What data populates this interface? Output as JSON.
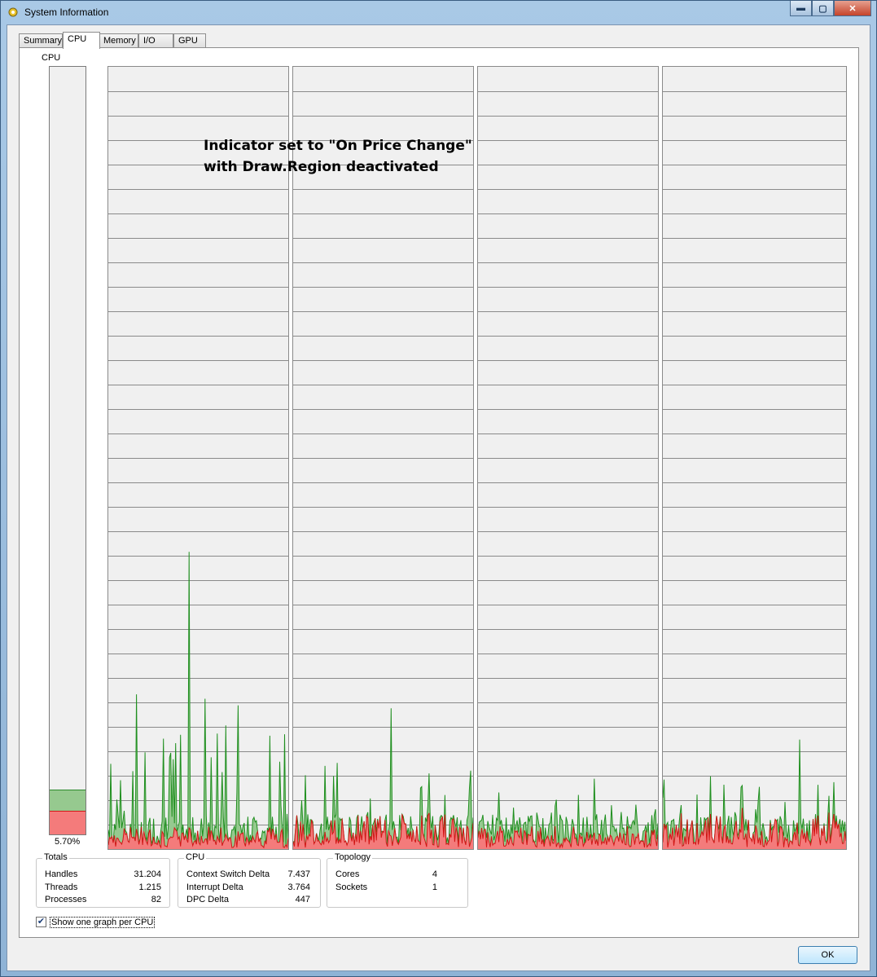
{
  "window": {
    "title": "System Information"
  },
  "tabs": [
    {
      "label": "Summary",
      "active": false
    },
    {
      "label": "CPU",
      "active": true
    },
    {
      "label": "Memory",
      "active": false
    },
    {
      "label": "I/O",
      "active": false
    },
    {
      "label": "GPU",
      "active": false
    }
  ],
  "cpu_meter": {
    "label": "CPU",
    "value_text": "5.70%",
    "total_fraction": 0.028,
    "kernel_fraction": 0.03
  },
  "annotation": {
    "line1": "Indicator set to \"On Price Change\"",
    "line2": "with Draw.Region deactivated"
  },
  "totals": {
    "title": "Totals",
    "rows": [
      {
        "label": "Handles",
        "value": "31.204"
      },
      {
        "label": "Threads",
        "value": "1.215"
      },
      {
        "label": "Processes",
        "value": "82"
      }
    ]
  },
  "cpu_stats": {
    "title": "CPU",
    "rows": [
      {
        "label": "Context Switch Delta",
        "value": "7.437"
      },
      {
        "label": "Interrupt Delta",
        "value": "3.764"
      },
      {
        "label": "DPC Delta",
        "value": "447"
      }
    ]
  },
  "topology": {
    "title": "Topology",
    "rows": [
      {
        "label": "Cores",
        "value": "4"
      },
      {
        "label": "Sockets",
        "value": "1"
      }
    ]
  },
  "show_per_cpu": {
    "label": "Show one graph per CPU",
    "checked": true
  },
  "ok_button": {
    "label": "OK"
  },
  "colors": {
    "total_fill": "#96c98f",
    "total_line": "#1f8f1f",
    "kernel_fill": "#f47b7b",
    "kernel_line": "#d21616",
    "grid": "#8a8a8a"
  },
  "graphs": {
    "count": 4,
    "grid_rows": 32,
    "peaks_total": [
      0.38,
      0.18,
      0.09,
      0.14
    ],
    "peaks_kernel": [
      0.05,
      0.09,
      0.05,
      0.1
    ]
  }
}
